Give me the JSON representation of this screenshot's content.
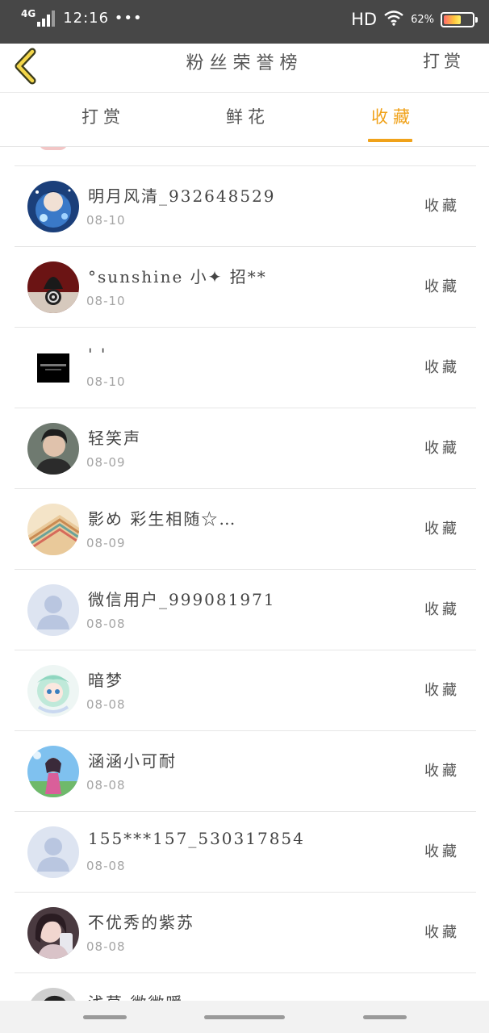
{
  "status_bar": {
    "network": "4G",
    "time": "12:16 •••",
    "hd": "HD",
    "battery_pct": "62%",
    "battery_level": 0.62,
    "icons": [
      "signal-icon",
      "wifi-icon",
      "battery-icon"
    ]
  },
  "header": {
    "title": "粉丝荣誉榜",
    "action": "打赏",
    "back_icon": "back-chevron-icon",
    "accent": "#f0a21a"
  },
  "tabs": [
    {
      "label": "打赏",
      "active": false
    },
    {
      "label": "鲜花",
      "active": false
    },
    {
      "label": "收藏",
      "active": true
    }
  ],
  "list": {
    "action_label": "收藏",
    "items": [
      {
        "name": "明月风清_932648529",
        "date": "08-10",
        "avatar": "anime-avatar-blue"
      },
      {
        "name": "°sunshine 小✦    招**",
        "date": "08-10",
        "avatar": "camera-lens-avatar"
      },
      {
        "name": "' '",
        "date": "08-10",
        "avatar": "black-logo-avatar"
      },
      {
        "name": "轻笑声",
        "date": "08-09",
        "avatar": "man-portrait-avatar"
      },
      {
        "name": "影め 彩生相随☆…",
        "date": "08-09",
        "avatar": "notebook-avatar"
      },
      {
        "name": "微信用户_999081971",
        "date": "08-08",
        "avatar": "default-user-avatar"
      },
      {
        "name": "暗梦",
        "date": "08-08",
        "avatar": "anime-avatar-green"
      },
      {
        "name": "涵涵小可耐",
        "date": "08-08",
        "avatar": "anime-girl-sky-avatar"
      },
      {
        "name": "155***157_530317854",
        "date": "08-08",
        "avatar": "default-user-avatar"
      },
      {
        "name": "不优秀的紫苏",
        "date": "08-08",
        "avatar": "girl-portrait-avatar"
      },
      {
        "name": "浅莫   微微暖",
        "date": "",
        "avatar": "partial-avatar"
      }
    ]
  }
}
